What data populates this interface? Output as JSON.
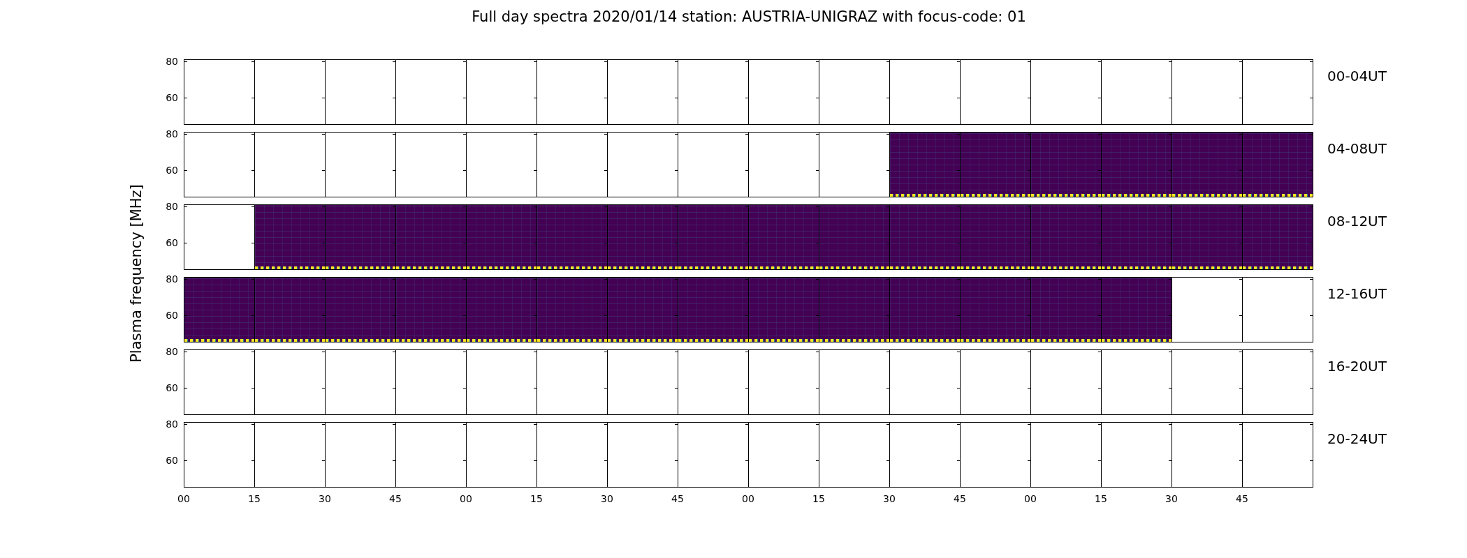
{
  "title": "Full day spectra 2020/01/14 station: AUSTRIA-UNIGRAZ with focus-code: 01",
  "y_label": "Plasma frequency [MHz]",
  "rows": [
    {
      "label": "00-04UT",
      "y_ticks": [
        "80",
        "60"
      ],
      "cells": [
        {
          "filled": false
        },
        {
          "filled": false
        },
        {
          "filled": false
        },
        {
          "filled": false
        },
        {
          "filled": false
        },
        {
          "filled": false
        },
        {
          "filled": false
        },
        {
          "filled": false
        },
        {
          "filled": false
        },
        {
          "filled": false
        },
        {
          "filled": false
        },
        {
          "filled": false
        },
        {
          "filled": false
        },
        {
          "filled": false
        },
        {
          "filled": false
        },
        {
          "filled": false
        }
      ]
    },
    {
      "label": "04-08UT",
      "y_ticks": [
        "80",
        "60"
      ],
      "cells": [
        {
          "filled": false
        },
        {
          "filled": false
        },
        {
          "filled": false
        },
        {
          "filled": false
        },
        {
          "filled": false
        },
        {
          "filled": false
        },
        {
          "filled": false
        },
        {
          "filled": false
        },
        {
          "filled": false
        },
        {
          "filled": false
        },
        {
          "filled": true
        },
        {
          "filled": true
        },
        {
          "filled": true
        },
        {
          "filled": true
        },
        {
          "filled": true
        },
        {
          "filled": true
        }
      ]
    },
    {
      "label": "08-12UT",
      "y_ticks": [
        "80",
        "60"
      ],
      "cells": [
        {
          "filled": false
        },
        {
          "filled": true
        },
        {
          "filled": true
        },
        {
          "filled": true
        },
        {
          "filled": true
        },
        {
          "filled": true
        },
        {
          "filled": true
        },
        {
          "filled": true
        },
        {
          "filled": true
        },
        {
          "filled": true
        },
        {
          "filled": true
        },
        {
          "filled": true
        },
        {
          "filled": true
        },
        {
          "filled": true
        },
        {
          "filled": true
        },
        {
          "filled": true
        }
      ]
    },
    {
      "label": "12-16UT",
      "y_ticks": [
        "80",
        "60"
      ],
      "cells": [
        {
          "filled": true
        },
        {
          "filled": true
        },
        {
          "filled": true
        },
        {
          "filled": true
        },
        {
          "filled": true
        },
        {
          "filled": true
        },
        {
          "filled": true
        },
        {
          "filled": true
        },
        {
          "filled": true
        },
        {
          "filled": true
        },
        {
          "filled": true
        },
        {
          "filled": true
        },
        {
          "filled": true
        },
        {
          "filled": true
        },
        {
          "filled": false
        },
        {
          "filled": false
        }
      ]
    },
    {
      "label": "16-20UT",
      "y_ticks": [
        "80",
        "60"
      ],
      "cells": [
        {
          "filled": false
        },
        {
          "filled": false
        },
        {
          "filled": false
        },
        {
          "filled": false
        },
        {
          "filled": false
        },
        {
          "filled": false
        },
        {
          "filled": false
        },
        {
          "filled": false
        },
        {
          "filled": false
        },
        {
          "filled": false
        },
        {
          "filled": false
        },
        {
          "filled": false
        },
        {
          "filled": false
        },
        {
          "filled": false
        },
        {
          "filled": false
        },
        {
          "filled": false
        }
      ]
    },
    {
      "label": "20-24UT",
      "y_ticks": [
        "80",
        "60"
      ],
      "cells": [
        {
          "filled": false
        },
        {
          "filled": false
        },
        {
          "filled": false
        },
        {
          "filled": false
        },
        {
          "filled": false
        },
        {
          "filled": false
        },
        {
          "filled": false
        },
        {
          "filled": false
        },
        {
          "filled": false
        },
        {
          "filled": false
        },
        {
          "filled": false
        },
        {
          "filled": false
        },
        {
          "filled": false
        },
        {
          "filled": false
        },
        {
          "filled": false
        },
        {
          "filled": false
        }
      ]
    }
  ],
  "x_ticks": [
    "00",
    "15",
    "30",
    "45",
    "00",
    "15",
    "30",
    "45",
    "00",
    "15",
    "30",
    "45",
    "00",
    "15",
    "30",
    "45"
  ]
}
